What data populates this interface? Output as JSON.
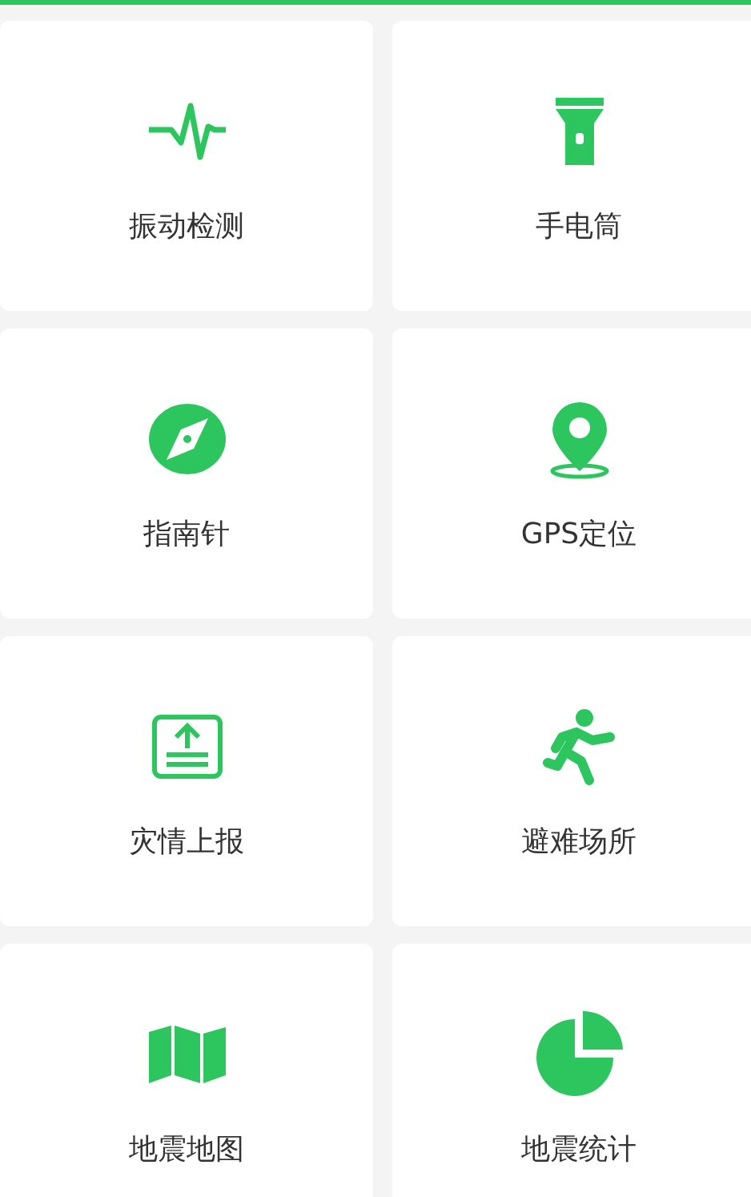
{
  "tiles": [
    {
      "label": "振动检测"
    },
    {
      "label": "手电筒"
    },
    {
      "label": "指南针"
    },
    {
      "label": "GPS定位"
    },
    {
      "label": "灾情上报"
    },
    {
      "label": "避难场所"
    },
    {
      "label": "地震地图"
    },
    {
      "label": "地震统计"
    }
  ]
}
